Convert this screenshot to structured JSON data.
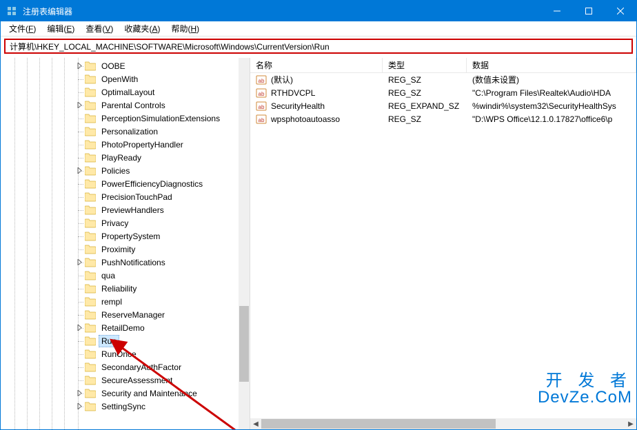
{
  "window": {
    "title": "注册表编辑器"
  },
  "menu": {
    "file": {
      "label": "文件",
      "hotkey": "F"
    },
    "edit": {
      "label": "编辑",
      "hotkey": "E"
    },
    "view": {
      "label": "查看",
      "hotkey": "V"
    },
    "fav": {
      "label": "收藏夹",
      "hotkey": "A"
    },
    "help": {
      "label": "帮助",
      "hotkey": "H"
    }
  },
  "address": "计算机\\HKEY_LOCAL_MACHINE\\SOFTWARE\\Microsoft\\Windows\\CurrentVersion\\Run",
  "tree": {
    "indent_base": 108,
    "items": [
      {
        "label": "OOBE",
        "expandable": true
      },
      {
        "label": "OpenWith"
      },
      {
        "label": "OptimalLayout"
      },
      {
        "label": "Parental Controls",
        "expandable": true
      },
      {
        "label": "PerceptionSimulationExtensions"
      },
      {
        "label": "Personalization"
      },
      {
        "label": "PhotoPropertyHandler"
      },
      {
        "label": "PlayReady"
      },
      {
        "label": "Policies",
        "expandable": true
      },
      {
        "label": "PowerEfficiencyDiagnostics"
      },
      {
        "label": "PrecisionTouchPad"
      },
      {
        "label": "PreviewHandlers"
      },
      {
        "label": "Privacy"
      },
      {
        "label": "PropertySystem"
      },
      {
        "label": "Proximity"
      },
      {
        "label": "PushNotifications",
        "expandable": true
      },
      {
        "label": "qua"
      },
      {
        "label": "Reliability"
      },
      {
        "label": "rempl"
      },
      {
        "label": "ReserveManager"
      },
      {
        "label": "RetailDemo",
        "expandable": true
      },
      {
        "label": "Run",
        "selected": true
      },
      {
        "label": "RunOnce"
      },
      {
        "label": "SecondaryAuthFactor"
      },
      {
        "label": "SecureAssessment"
      },
      {
        "label": "Security and Maintenance",
        "expandable": true
      },
      {
        "label": "SettingSync",
        "expandable": true
      }
    ]
  },
  "columns": {
    "name": "名称",
    "type": "类型",
    "data": "数据"
  },
  "values": [
    {
      "name": "(默认)",
      "type": "REG_SZ",
      "data": "(数值未设置)"
    },
    {
      "name": "RTHDVCPL",
      "type": "REG_SZ",
      "data": "\"C:\\Program Files\\Realtek\\Audio\\HDA"
    },
    {
      "name": "SecurityHealth",
      "type": "REG_EXPAND_SZ",
      "data": "%windir%\\system32\\SecurityHealthSys"
    },
    {
      "name": "wpsphotoautoasso",
      "type": "REG_SZ",
      "data": "\"D:\\WPS Office\\12.1.0.17827\\office6\\p"
    }
  ],
  "watermark": {
    "line1": "开 发 者",
    "line2": "DevZe.CoM"
  }
}
